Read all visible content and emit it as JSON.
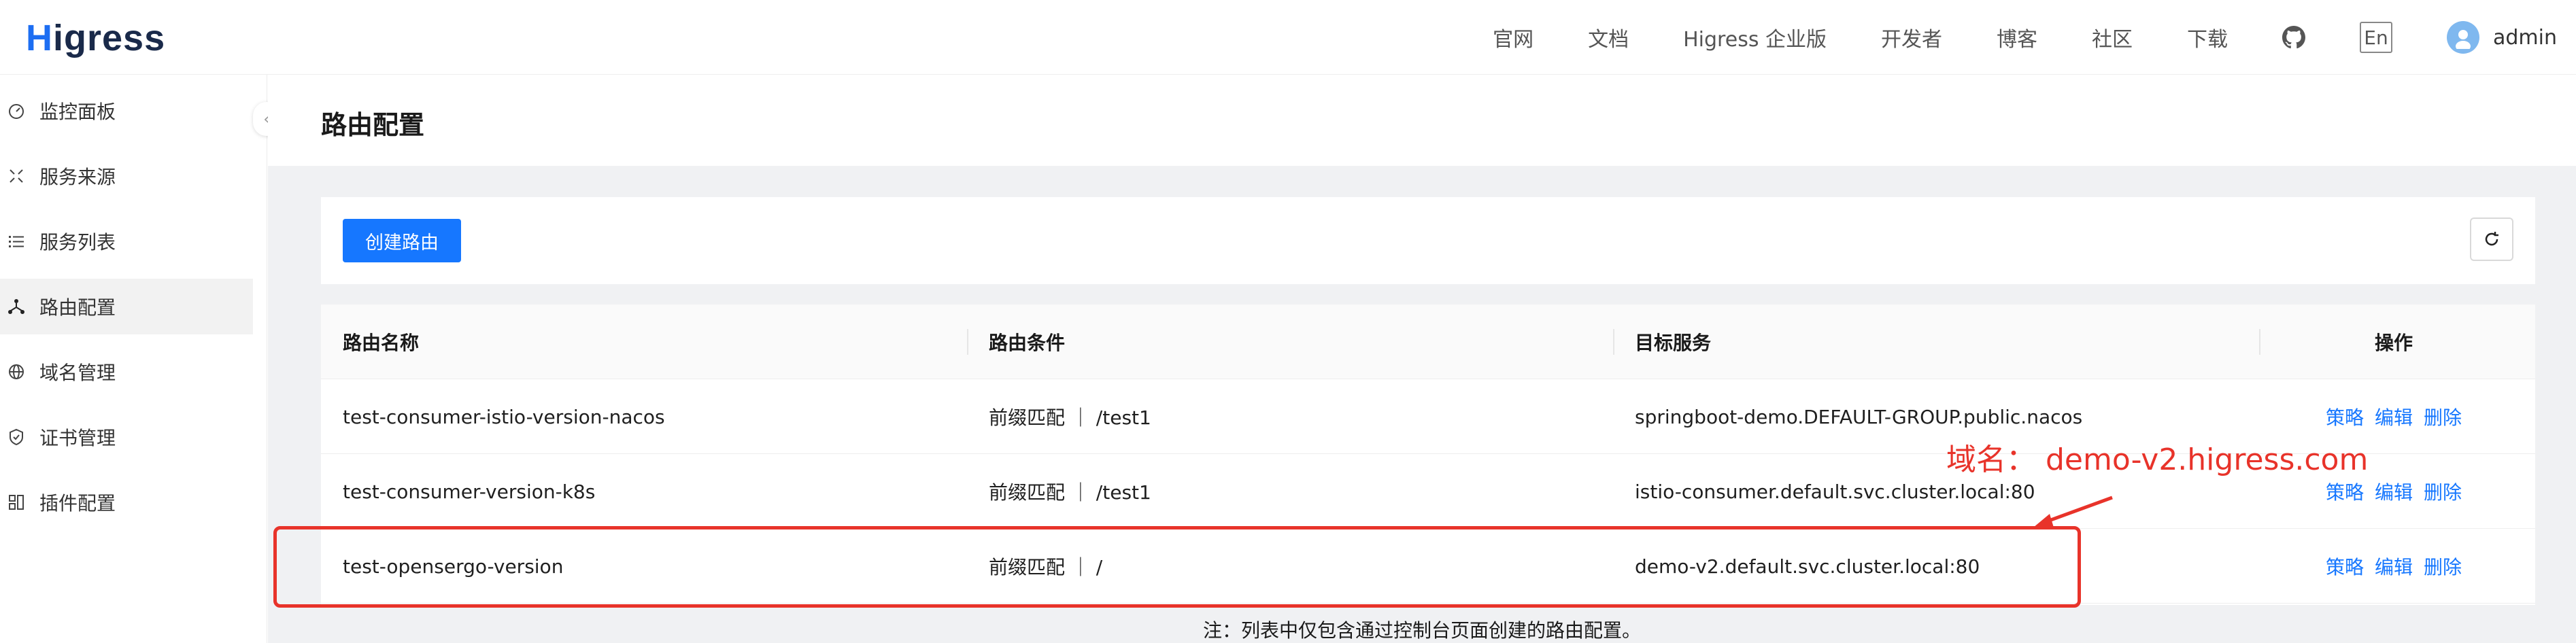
{
  "header": {
    "logo_h": "H",
    "logo_rest": "igress",
    "nav": [
      "官网",
      "文档",
      "Higress 企业版",
      "开发者",
      "博客",
      "社区",
      "下载"
    ],
    "lang_label": "En",
    "user_name": "admin"
  },
  "sidebar": {
    "items": [
      {
        "label": "监控面板",
        "icon": "dashboard-icon"
      },
      {
        "label": "服务来源",
        "icon": "service-source-icon"
      },
      {
        "label": "服务列表",
        "icon": "list-icon"
      },
      {
        "label": "路由配置",
        "icon": "route-icon",
        "active": true
      },
      {
        "label": "域名管理",
        "icon": "globe-icon"
      },
      {
        "label": "证书管理",
        "icon": "certificate-icon"
      },
      {
        "label": "插件配置",
        "icon": "plugin-icon"
      }
    ]
  },
  "page": {
    "title": "路由配置",
    "create_button": "创建路由",
    "refresh_icon": "refresh-icon"
  },
  "table": {
    "columns": [
      "路由名称",
      "路由条件",
      "目标服务",
      "操作"
    ],
    "rows": [
      {
        "name": "test-consumer-istio-version-nacos",
        "condition": "前缀匹配 ｜ /test1",
        "service": "springboot-demo.DEFAULT-GROUP.public.nacos"
      },
      {
        "name": "test-consumer-version-k8s",
        "condition": "前缀匹配 ｜ /test1",
        "service": "istio-consumer.default.svc.cluster.local:80"
      },
      {
        "name": "test-opensergo-version",
        "condition": "前缀匹配 ｜ /",
        "service": "demo-v2.default.svc.cluster.local:80"
      }
    ],
    "actions": [
      "策略",
      "编辑",
      "删除"
    ]
  },
  "footnote": "注：列表中仅包含通过控制台页面创建的路由配置。",
  "annotation": {
    "text": "域名： demo-v2.higress.com",
    "color": "#e8332a"
  },
  "colors": {
    "primary": "#1677ff",
    "annotation": "#e8332a"
  }
}
